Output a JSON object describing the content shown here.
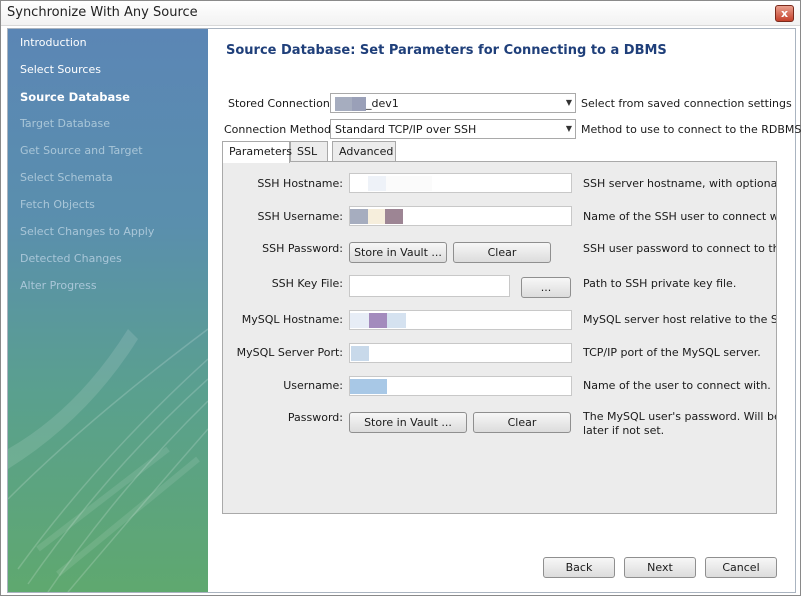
{
  "window": {
    "title": "Synchronize With Any Source",
    "close_glyph": "x"
  },
  "sidebar": {
    "items": [
      {
        "label": "Introduction",
        "state": "done"
      },
      {
        "label": "Select Sources",
        "state": "done"
      },
      {
        "label": "Source Database",
        "state": "active"
      },
      {
        "label": "Target Database",
        "state": "pending"
      },
      {
        "label": "Get Source and Target",
        "state": "pending"
      },
      {
        "label": "Select Schemata",
        "state": "pending"
      },
      {
        "label": "Fetch Objects",
        "state": "pending"
      },
      {
        "label": "Select Changes to Apply",
        "state": "pending"
      },
      {
        "label": "Detected Changes",
        "state": "pending"
      },
      {
        "label": "Alter Progress",
        "state": "pending"
      }
    ]
  },
  "main": {
    "heading": "Source Database: Set Parameters for Connecting to a DBMS",
    "stored_connection": {
      "label": "Stored Connection:",
      "value_suffix": "_dev1",
      "hint": "Select from saved connection settings"
    },
    "connection_method": {
      "label": "Connection Method:",
      "value": "Standard TCP/IP over SSH",
      "hint": "Method to use to connect to the RDBMS"
    },
    "tabs": [
      {
        "label": "Parameters",
        "active": true
      },
      {
        "label": "SSL",
        "active": false
      },
      {
        "label": "Advanced",
        "active": false
      }
    ],
    "params": {
      "ssh_hostname": {
        "label": "SSH Hostname:",
        "hint": "SSH server hostname, with  optional por"
      },
      "ssh_username": {
        "label": "SSH Username:",
        "hint": "Name of the SSH user to connect with."
      },
      "ssh_password": {
        "label": "SSH Password:",
        "store_label": "Store in Vault ...",
        "clear_label": "Clear",
        "hint": "SSH user password to connect to the SS"
      },
      "ssh_key_file": {
        "label": "SSH Key File:",
        "browse_label": "...",
        "hint": "Path to SSH private key file."
      },
      "mysql_hostname": {
        "label": "MySQL Hostname:",
        "hint": "MySQL server host relative to the SSH s"
      },
      "mysql_port": {
        "label": "MySQL Server Port:",
        "hint": "TCP/IP port of the MySQL server."
      },
      "username": {
        "label": "Username:",
        "hint": "Name of the user to connect with."
      },
      "password": {
        "label": "Password:",
        "store_label": "Store in Vault ...",
        "clear_label": "Clear",
        "hint_line1": "The MySQL user's password. Will be req",
        "hint_line2": "later if not set."
      }
    }
  },
  "footer": {
    "back_label": "Back",
    "next_label": "Next",
    "cancel_label": "Cancel"
  },
  "colors": {
    "heading": "#1f3f7a",
    "sidebar_top": "#5b86b5",
    "sidebar_bottom": "#5fa86f",
    "redaction_1": "#a6adbf",
    "redaction_2": "#f6eedc",
    "redaction_3": "#9d8594",
    "redaction_4": "#a38bbd",
    "redaction_5": "#d5e2f0",
    "redaction_6": "#a8c8e6"
  }
}
